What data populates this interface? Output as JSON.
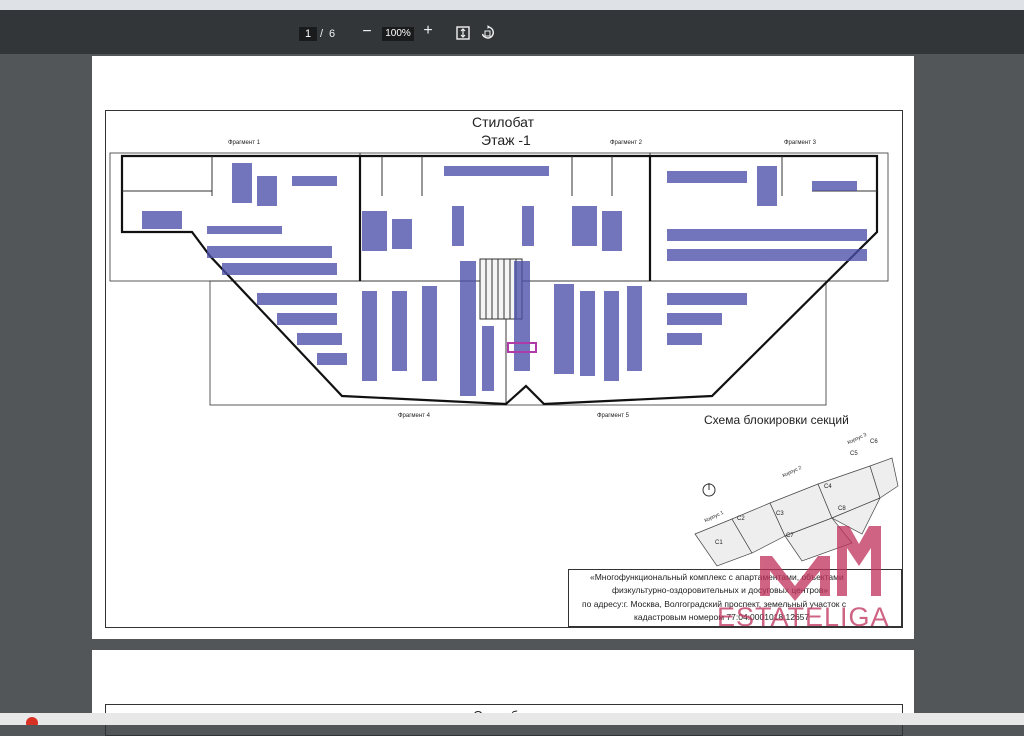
{
  "viewer": {
    "page_current": "1",
    "page_separator": "/",
    "page_total": "6",
    "zoom_out": "−",
    "zoom_level": "100%",
    "zoom_in": "+",
    "icons": [
      "fit-to-page-icon",
      "rotate-icon"
    ]
  },
  "plan": {
    "title": "Стилобат",
    "subtitle": "Этаж -1",
    "fragments": [
      "Фрагмент 1",
      "Фрагмент 2",
      "Фрагмент 3",
      "Фрагмент 4",
      "Фрагмент 5"
    ]
  },
  "scheme": {
    "title": "Схема блокировки секций",
    "corpus_labels": [
      "Корпус 1",
      "Корпус 2",
      "Корпус 3"
    ],
    "sections": [
      "С1",
      "С2",
      "С3",
      "С4",
      "С5",
      "С6",
      "С7",
      "С8"
    ]
  },
  "stamp": {
    "lines": [
      "«Многофункциональный комплекс с апартаментами, объектами",
      "физкультурно-оздоровительных и досуговых центров»",
      "по адресу:г. Москва, Волгоградский проспект, земельный участок с",
      "кадастровым номером 77:04:0001018:12657"
    ]
  },
  "watermark": {
    "text": "ESTATELIGA"
  },
  "page2": {
    "title": "Стилобат"
  },
  "colors": {
    "toolbar": "#323639",
    "viewer_bg": "#525659",
    "parking": "#4b4fa8",
    "watermark": "#c0305a",
    "highlight": "#b03aa8"
  }
}
